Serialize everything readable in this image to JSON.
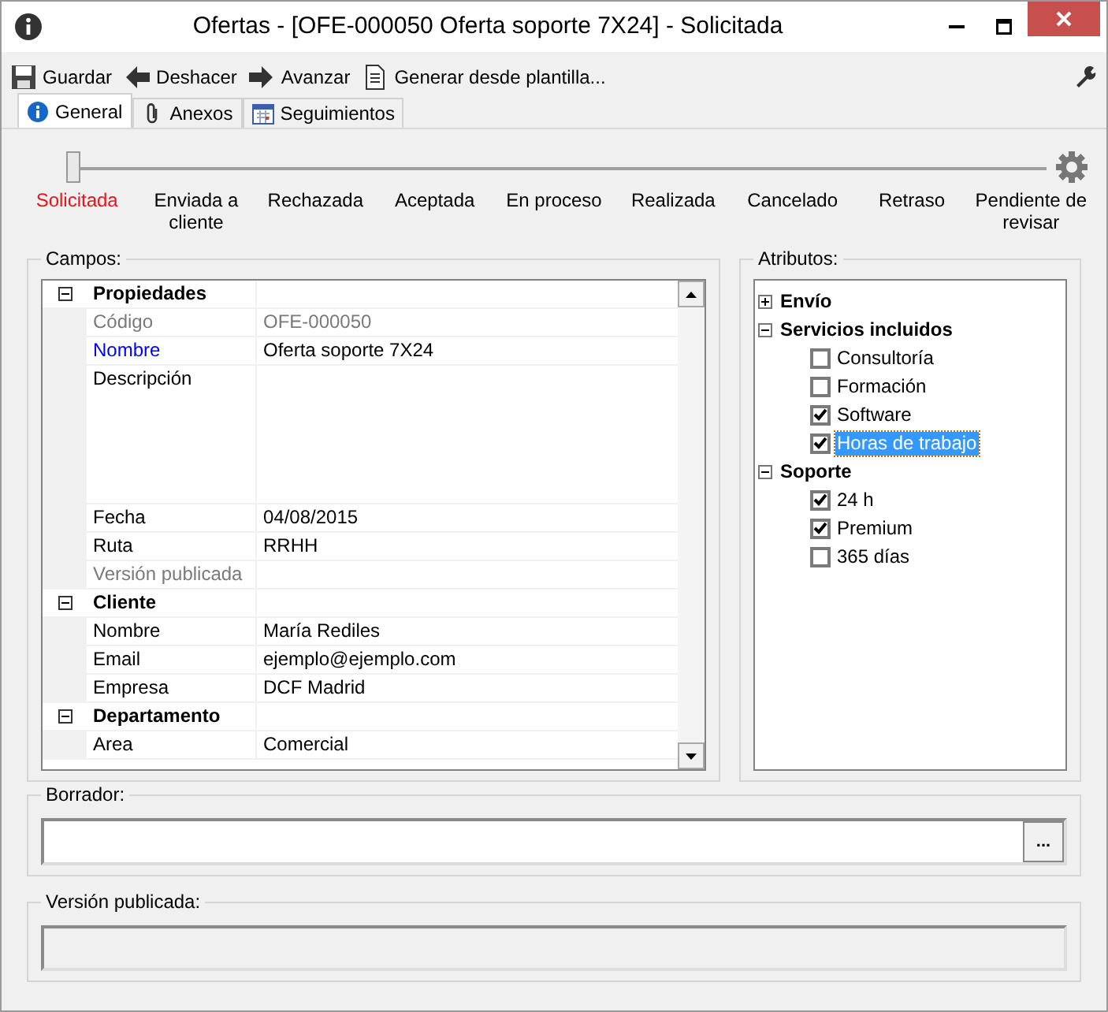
{
  "window": {
    "title": "Ofertas - [OFE-000050 Oferta soporte 7X24] - Solicitada"
  },
  "toolbar": {
    "buttons": [
      {
        "kind": "save",
        "label": "Guardar"
      },
      {
        "kind": "undo",
        "label": "Deshacer"
      },
      {
        "kind": "forward",
        "label": "Avanzar"
      },
      {
        "kind": "template",
        "label": "Generar desde plantilla..."
      }
    ]
  },
  "tabs": [
    {
      "kind": "info",
      "label": "General",
      "selected": true
    },
    {
      "kind": "attach",
      "label": "Anexos",
      "selected": false
    },
    {
      "kind": "calendar",
      "label": "Seguimientos",
      "selected": false
    }
  ],
  "stepper": {
    "level": 0,
    "steps": [
      {
        "label": "Solicitada",
        "selected": true
      },
      {
        "label": "Enviada a cliente",
        "selected": false
      },
      {
        "label": "Rechazada",
        "selected": false
      },
      {
        "label": "Aceptada",
        "selected": false
      },
      {
        "label": "En proceso",
        "selected": false
      },
      {
        "label": "Realizada",
        "selected": false
      },
      {
        "label": "Cancelado",
        "selected": false
      },
      {
        "label": "Retraso",
        "selected": false
      },
      {
        "label": "Pendiente de revisar",
        "selected": false
      }
    ]
  },
  "campos": {
    "title": "Campos:",
    "groups": [
      {
        "name": "Propiedades",
        "expanded": true,
        "rows": [
          {
            "label": "Código",
            "value": "OFE-000050",
            "kind": "readonly"
          },
          {
            "label": "Nombre",
            "value": "Oferta soporte 7X24",
            "kind": "required"
          },
          {
            "label": "Descripción",
            "kind": "multiline"
          },
          {
            "label": "Fecha",
            "value": "04/08/2015",
            "kind": "normal"
          },
          {
            "label": "Ruta",
            "value": "RRHH",
            "kind": "normal"
          },
          {
            "label": "Versión publicada",
            "kind": "readonly"
          }
        ]
      },
      {
        "name": "Cliente",
        "expanded": true,
        "rows": [
          {
            "label": "Nombre",
            "value": "María Rediles",
            "kind": "normal"
          },
          {
            "label": "Email",
            "value": "ejemplo@ejemplo.com",
            "kind": "normal"
          },
          {
            "label": "Empresa",
            "value": "DCF Madrid",
            "kind": "normal"
          }
        ]
      },
      {
        "name": "Departamento",
        "expanded": true,
        "rows": [
          {
            "label": "Area",
            "value": "Comercial",
            "kind": "normal"
          }
        ]
      }
    ]
  },
  "atributos": {
    "title": "Atributos:",
    "groups": [
      {
        "name": "Envío",
        "expanded": false
      },
      {
        "name": "Servicios incluidos",
        "expanded": true,
        "items": [
          {
            "label": "Consultoría",
            "checked": false,
            "selected": false
          },
          {
            "label": "Formación",
            "checked": false,
            "selected": false
          },
          {
            "label": "Software",
            "checked": true,
            "selected": false
          },
          {
            "label": "Horas de trabajo",
            "checked": true,
            "selected": true
          }
        ]
      },
      {
        "name": "Soporte",
        "expanded": true,
        "items": [
          {
            "label": "24 h",
            "checked": true,
            "selected": false
          },
          {
            "label": "Premium",
            "checked": true,
            "selected": false
          },
          {
            "label": "365 días",
            "checked": false,
            "selected": false
          }
        ]
      }
    ]
  },
  "borrador": {
    "title": "Borrador:",
    "button": "..."
  },
  "version_publicada": {
    "title": "Versión publicada:"
  }
}
